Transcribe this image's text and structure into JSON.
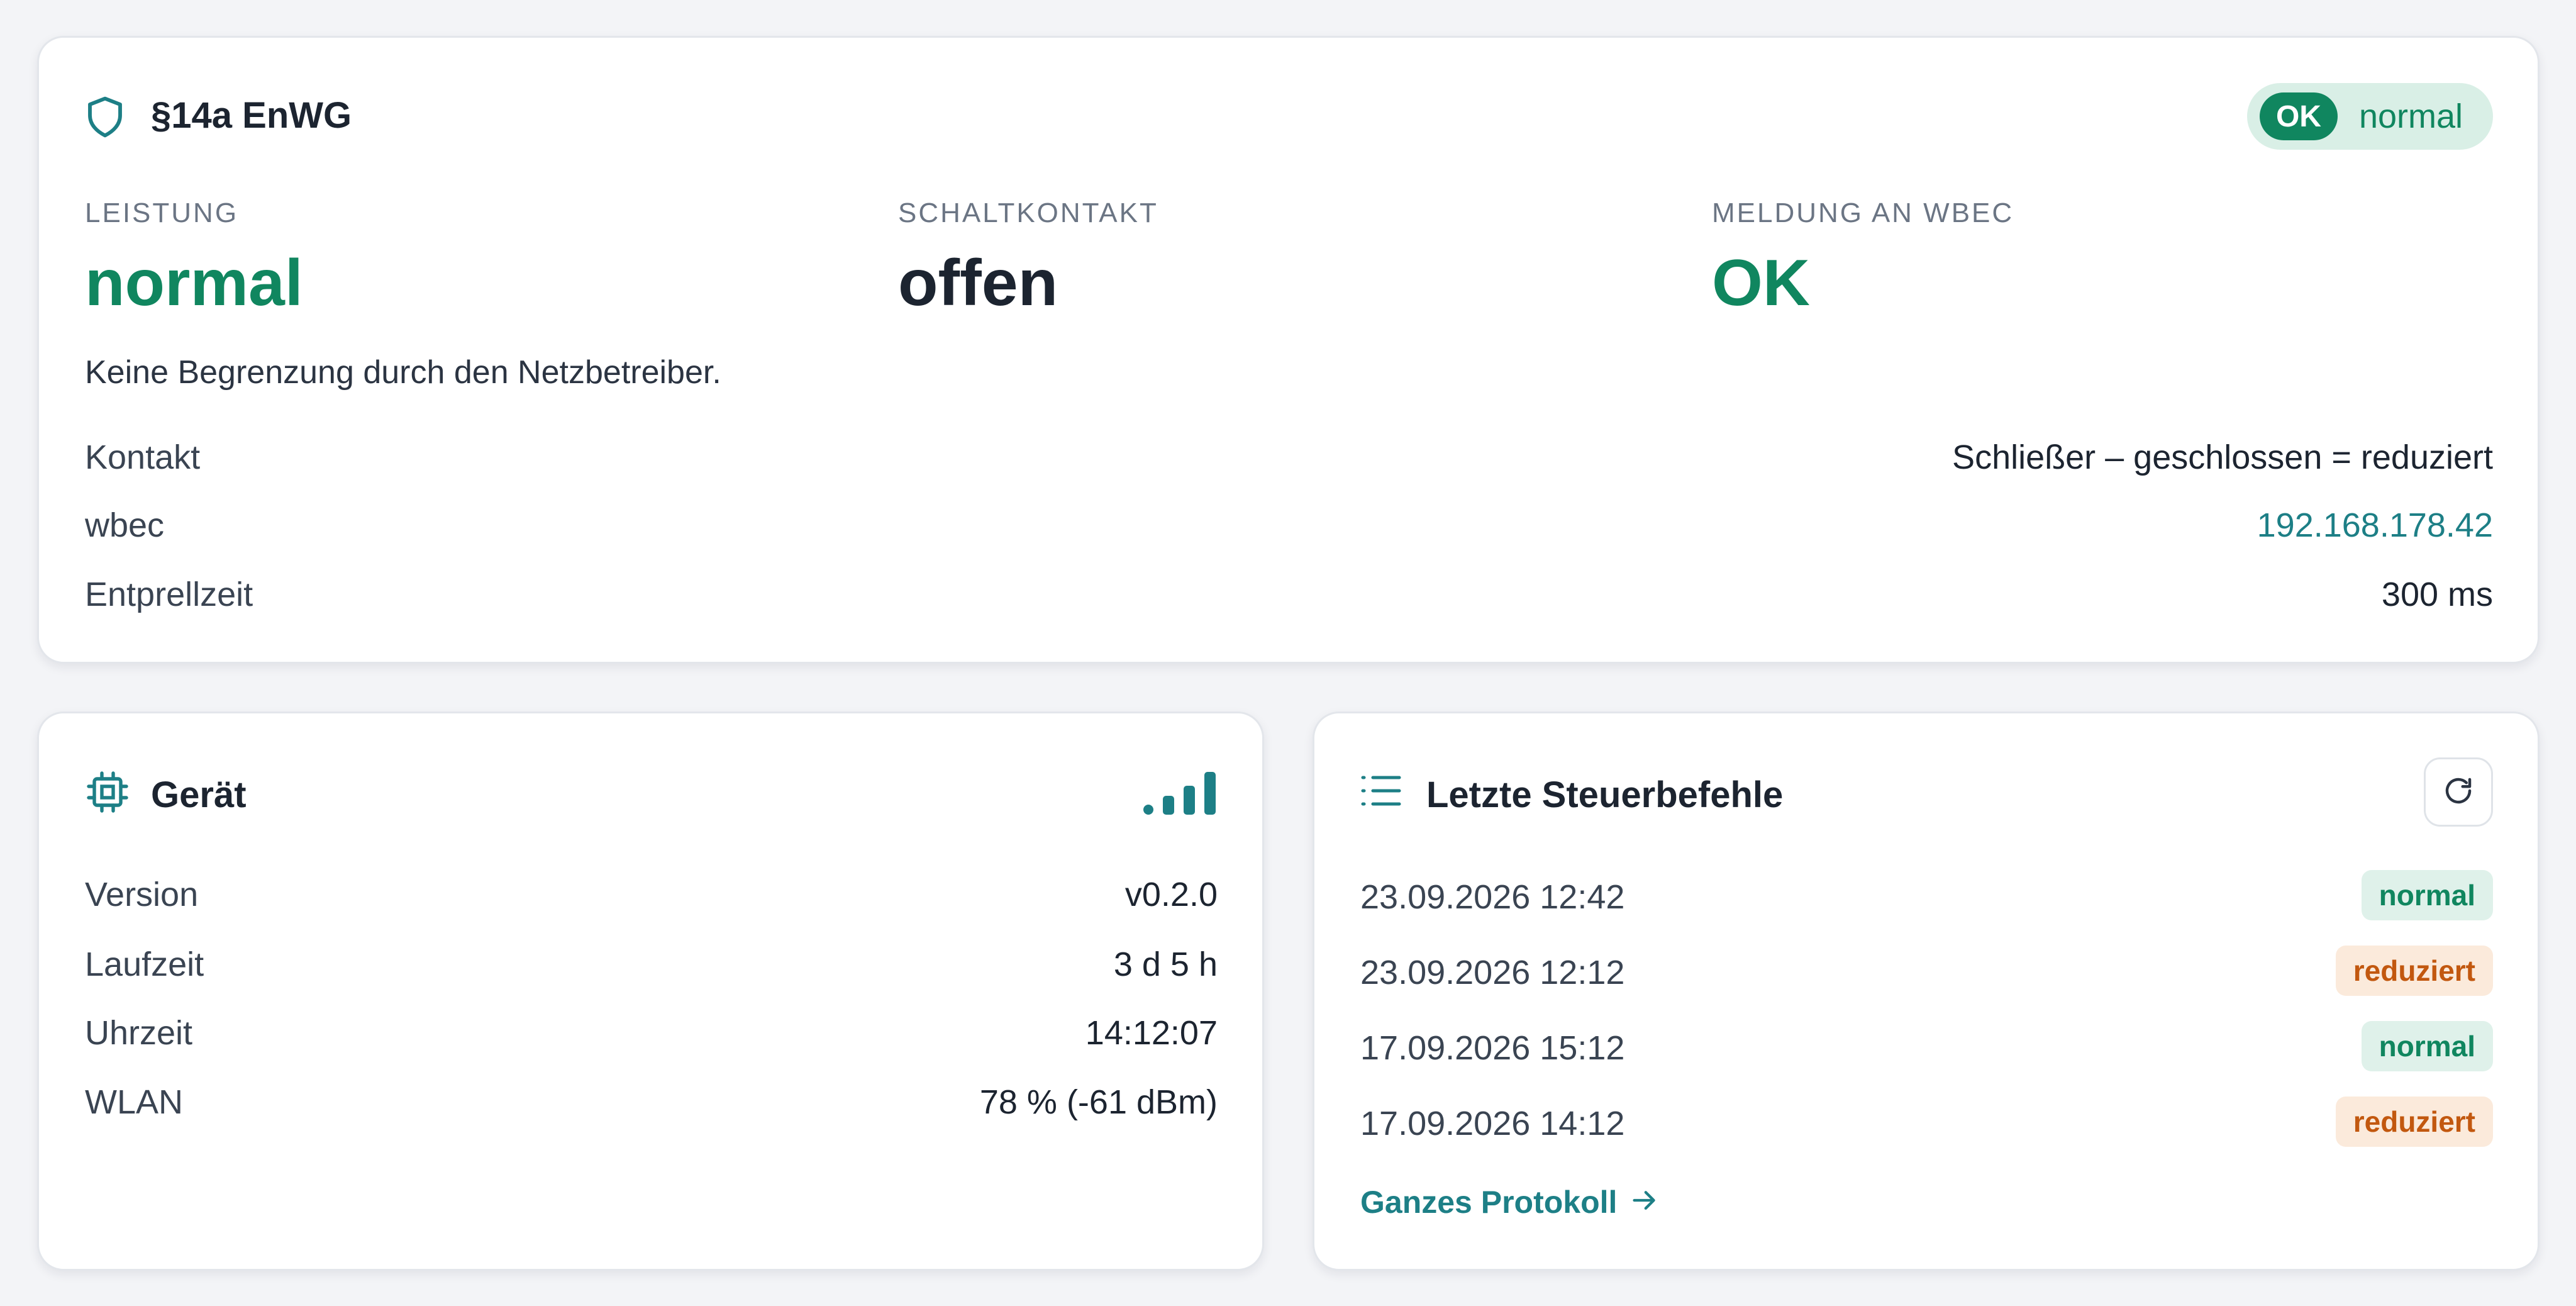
{
  "enwg": {
    "title": "§14a EnWG",
    "status_ok": "OK",
    "status_text": "normal",
    "stats": [
      {
        "label": "LEISTUNG",
        "value": "normal"
      },
      {
        "label": "SCHALTKONTAKT",
        "value": "offen"
      },
      {
        "label": "MELDUNG AN WBEC",
        "value": "OK"
      }
    ],
    "description": "Keine Begrenzung durch den Netzbetreiber.",
    "rows": [
      {
        "label": "Kontakt",
        "value": "Schließer – geschlossen = reduziert"
      },
      {
        "label": "wbec",
        "value": "192.168.178.42"
      },
      {
        "label": "Entprellzeit",
        "value": "300 ms"
      }
    ]
  },
  "device": {
    "title": "Gerät",
    "signal_icon": "signal-bars-icon",
    "rows": [
      {
        "label": "Version",
        "value": "v0.2.0"
      },
      {
        "label": "Laufzeit",
        "value": "3 d 5 h"
      },
      {
        "label": "Uhrzeit",
        "value": "14:12:07"
      },
      {
        "label": "WLAN",
        "value": "78 % (-61 dBm)"
      }
    ]
  },
  "commands": {
    "title": "Letzte Steuerbefehle",
    "entries": [
      {
        "time": "23.09.2026 12:42",
        "status": "normal"
      },
      {
        "time": "23.09.2026 12:12",
        "status": "reduziert"
      },
      {
        "time": "17.09.2026 15:12",
        "status": "normal"
      },
      {
        "time": "17.09.2026 14:12",
        "status": "reduziert"
      }
    ],
    "link_label": "Ganzes Protokoll"
  },
  "colors": {
    "accent": "#1d7f86",
    "ok_green": "#10865f",
    "reduced_orange": "#c2580f"
  }
}
